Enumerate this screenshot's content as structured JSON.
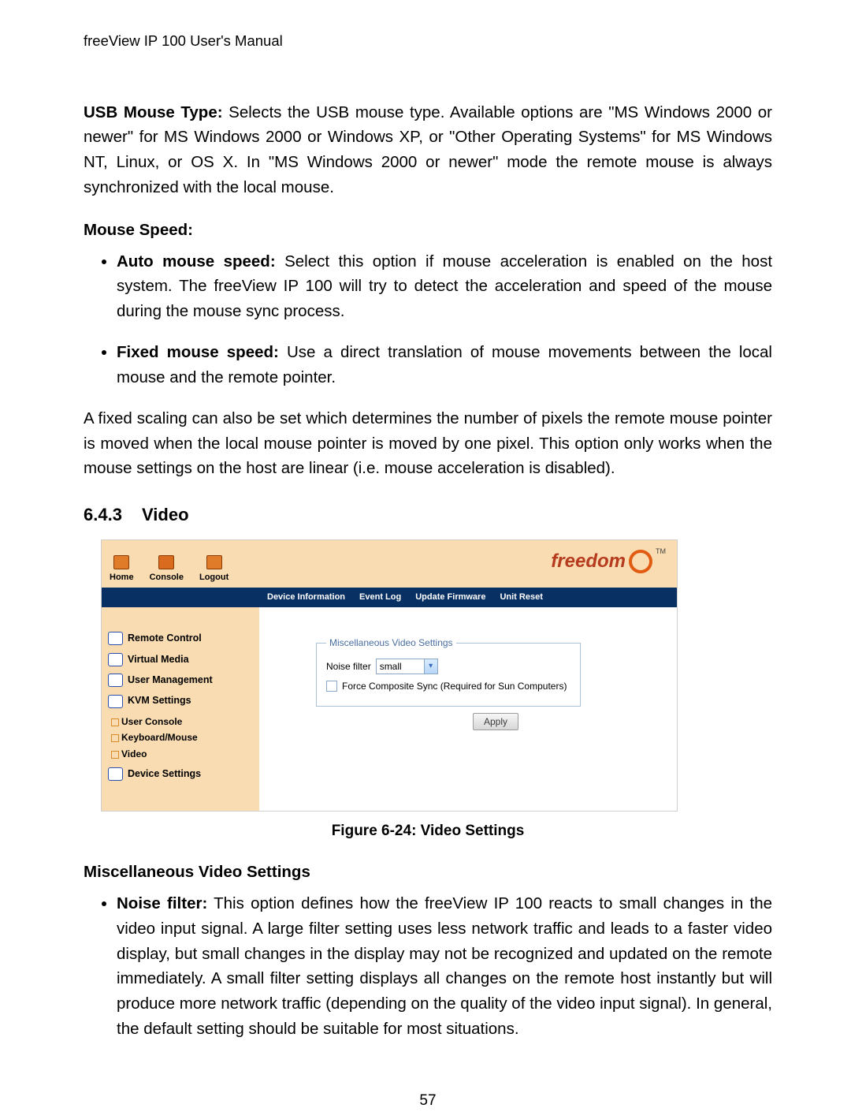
{
  "header": {
    "running": "freeView IP 100 User's Manual"
  },
  "paragraphs": {
    "usb_lead": "USB Mouse Type:",
    "usb_body": " Selects the USB mouse type. Available options are \"MS Windows 2000 or newer\" for MS Windows 2000 or Windows XP, or \"Other Operating Systems\" for MS Windows NT, Linux, or OS X. In \"MS Windows 2000 or newer\" mode the remote mouse is always synchronized with the local mouse.",
    "mouse_speed_heading": "Mouse Speed:",
    "auto_lead": "Auto mouse speed:",
    "auto_body": " Select this option if mouse acceleration is enabled on the host system. The freeView IP 100 will try to detect the acceleration and speed of the mouse during the mouse sync process.",
    "fixed_lead": "Fixed mouse speed:",
    "fixed_body": " Use a direct translation of mouse movements between the local mouse and the remote pointer.",
    "fixed_scaling": "A fixed scaling can also be set which determines the number of pixels the remote mouse pointer is moved when the local mouse pointer is moved by one pixel. This option only works when the mouse settings on the host are linear (i.e. mouse acceleration is disabled).",
    "misc_heading": "Miscellaneous Video Settings",
    "noise_lead": "Noise filter:",
    "noise_body": " This option defines how the freeView IP 100 reacts to small changes in the video input signal. A large filter setting uses less network traffic and leads to a faster video display, but small changes in the display may not be recognized and updated on the remote immediately. A small filter setting displays all changes on the remote host instantly but will produce more network traffic (depending on the quality of the video input signal). In general, the default setting should be suitable for most situations."
  },
  "section": {
    "number": "6.4.3",
    "title": "Video"
  },
  "figure": {
    "caption": "Figure 6-24: Video Settings"
  },
  "shot": {
    "nav": {
      "home": "Home",
      "console": "Console",
      "logout": "Logout"
    },
    "logo": "freedom",
    "logo_tm": "TM",
    "bluebar": [
      "Device Information",
      "Event Log",
      "Update Firmware",
      "Unit Reset"
    ],
    "sidebar": {
      "remote": "Remote Control",
      "virtual": "Virtual Media",
      "userman": "User Management",
      "kvm": "KVM Settings",
      "sub1": "User Console",
      "sub2": "Keyboard/Mouse",
      "sub3": "Video",
      "device": "Device Settings"
    },
    "panel": {
      "legend": "Miscellaneous Video Settings",
      "noise_label": "Noise filter",
      "noise_value": "small",
      "force_label": "Force Composite Sync (Required for Sun Computers)",
      "apply": "Apply"
    }
  },
  "page_number": "57"
}
